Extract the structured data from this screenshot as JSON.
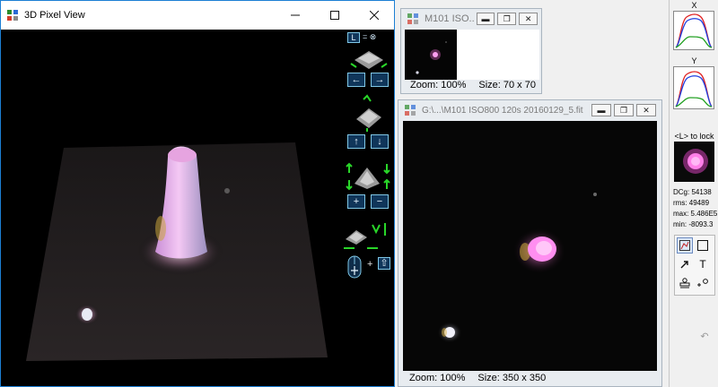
{
  "windows": {
    "pixel3d": {
      "title": "3D Pixel View",
      "lock_key_hint": "= ⊗",
      "lock_key": "L",
      "buttons": {
        "left_arrow": "←",
        "right_arrow": "→",
        "up_arrow": "↑",
        "down_arrow": "↓",
        "plus": "+",
        "minus": "−",
        "shift": "⇧",
        "mouse_plus": "+"
      }
    },
    "thumb": {
      "title": "M101 ISO...",
      "zoom": "Zoom: 100%",
      "size": "Size: 70 x 70"
    },
    "image": {
      "title": "G:\\...\\M101 ISO800 120s 20160129_5.fit",
      "zoom": "Zoom: 100%",
      "size": "Size: 350 x 350"
    }
  },
  "panel": {
    "x_label": "X",
    "y_label": "Y",
    "lock_label": "<L> to lock",
    "stats": {
      "dcg": "DCg: 54138",
      "rms": "rms: 49489",
      "max": "max: 5.486E5",
      "min": "min: -8093.3"
    },
    "tools": {
      "text": "T"
    },
    "colors": {
      "red": "#e02020",
      "blue": "#2040e0",
      "green": "#20a020"
    }
  }
}
